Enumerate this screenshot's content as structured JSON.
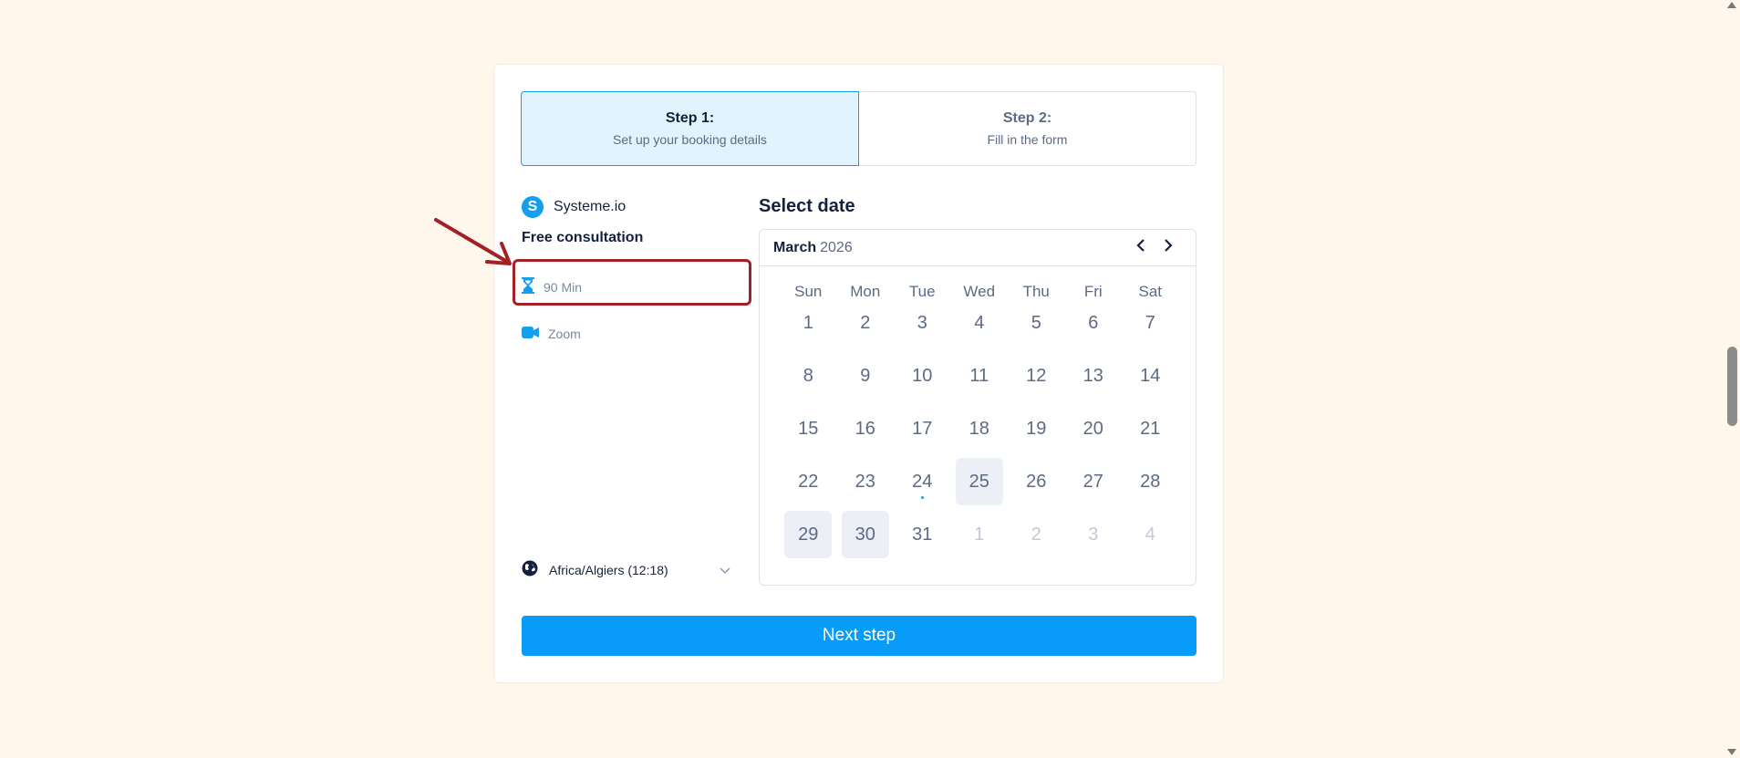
{
  "steps": [
    {
      "title": "Step 1:",
      "subtitle": "Set up your booking details"
    },
    {
      "title": "Step 2:",
      "subtitle": "Fill in the form"
    }
  ],
  "brand": {
    "logo_letter": "S",
    "name": "Systeme.io"
  },
  "event": {
    "title": "Free consultation",
    "duration": "90 Min",
    "duration_icon": "hourglass-icon",
    "location": "Zoom",
    "location_icon": "video-camera-icon"
  },
  "timezone": {
    "label": "Africa/Algiers (12:18)",
    "icon": "globe-icon"
  },
  "calendar": {
    "section_title": "Select date",
    "month": "March",
    "year": "2026",
    "weekdays": [
      "Sun",
      "Mon",
      "Tue",
      "Wed",
      "Thu",
      "Fri",
      "Sat"
    ],
    "days": [
      {
        "n": "1",
        "state": "normal"
      },
      {
        "n": "2",
        "state": "normal"
      },
      {
        "n": "3",
        "state": "normal"
      },
      {
        "n": "4",
        "state": "normal"
      },
      {
        "n": "5",
        "state": "normal"
      },
      {
        "n": "6",
        "state": "normal"
      },
      {
        "n": "7",
        "state": "normal"
      },
      {
        "n": "8",
        "state": "normal"
      },
      {
        "n": "9",
        "state": "normal"
      },
      {
        "n": "10",
        "state": "normal"
      },
      {
        "n": "11",
        "state": "normal"
      },
      {
        "n": "12",
        "state": "normal"
      },
      {
        "n": "13",
        "state": "normal"
      },
      {
        "n": "14",
        "state": "normal"
      },
      {
        "n": "15",
        "state": "normal"
      },
      {
        "n": "16",
        "state": "normal"
      },
      {
        "n": "17",
        "state": "normal"
      },
      {
        "n": "18",
        "state": "normal"
      },
      {
        "n": "19",
        "state": "normal"
      },
      {
        "n": "20",
        "state": "normal"
      },
      {
        "n": "21",
        "state": "normal"
      },
      {
        "n": "22",
        "state": "normal"
      },
      {
        "n": "23",
        "state": "normal"
      },
      {
        "n": "24",
        "state": "today"
      },
      {
        "n": "25",
        "state": "available"
      },
      {
        "n": "26",
        "state": "normal"
      },
      {
        "n": "27",
        "state": "normal"
      },
      {
        "n": "28",
        "state": "normal"
      },
      {
        "n": "29",
        "state": "available"
      },
      {
        "n": "30",
        "state": "available"
      },
      {
        "n": "31",
        "state": "normal"
      },
      {
        "n": "1",
        "state": "other"
      },
      {
        "n": "2",
        "state": "other"
      },
      {
        "n": "3",
        "state": "other"
      },
      {
        "n": "4",
        "state": "other"
      }
    ]
  },
  "next_button": "Next step",
  "colors": {
    "accent": "#089bf8",
    "highlight": "#a32025",
    "background": "#fff6ec"
  }
}
